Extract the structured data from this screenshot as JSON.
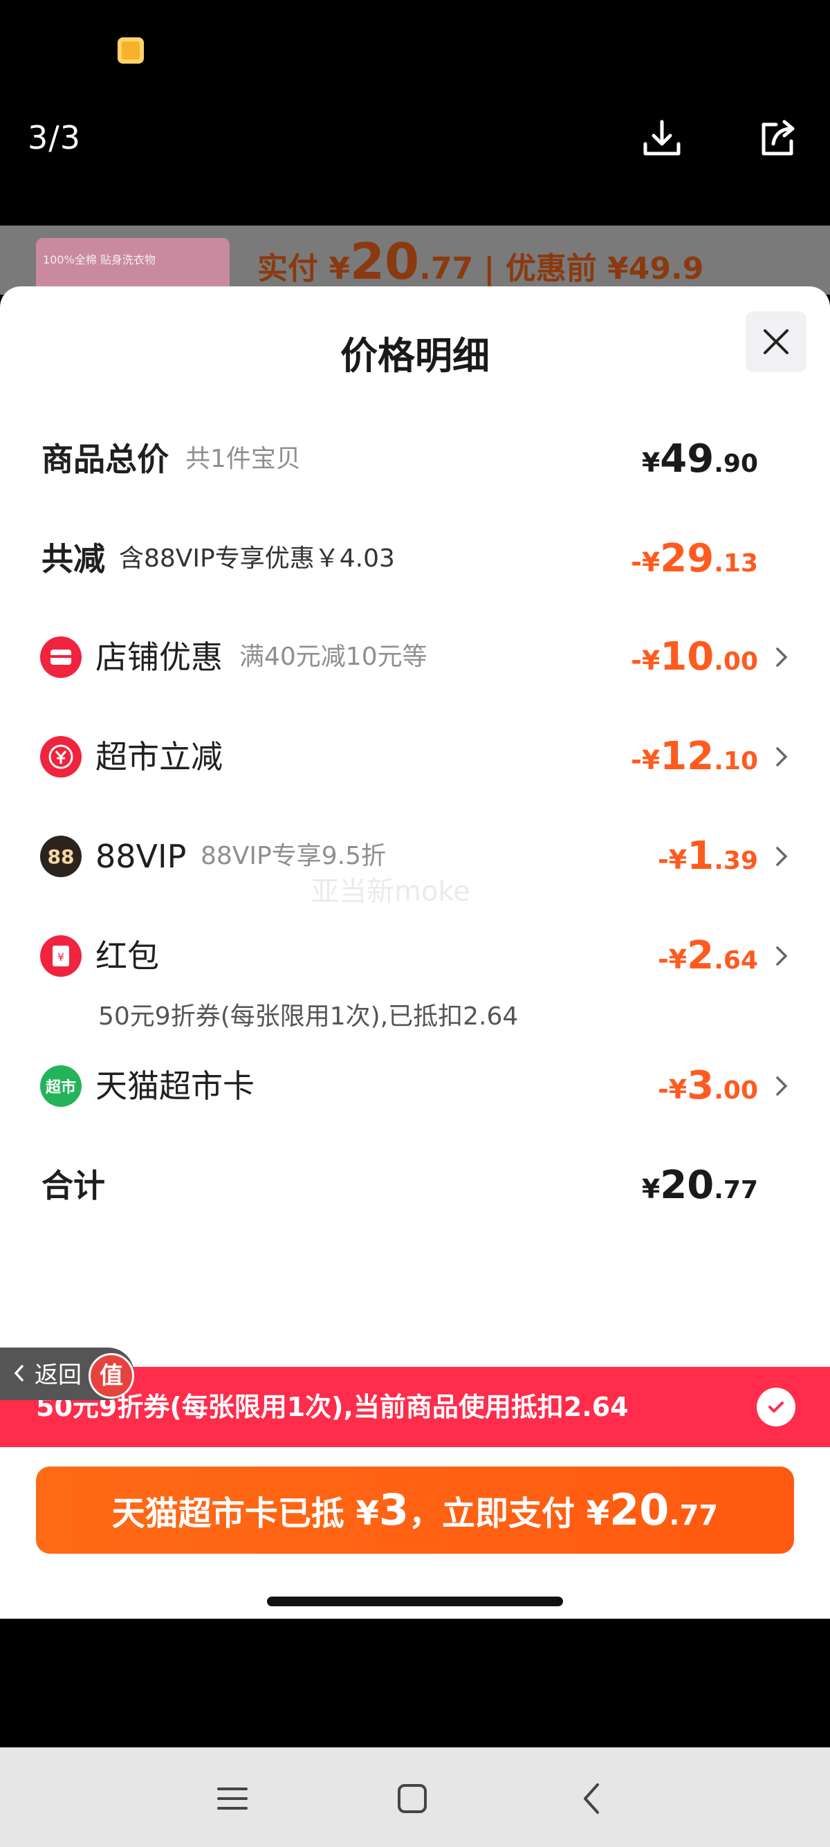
{
  "viewer": {
    "page_counter": "3/3",
    "icons": [
      "download-icon",
      "share-icon"
    ]
  },
  "background_product": {
    "thumb_text": "100%全棉 贴身洗衣物",
    "price_label": "实付 ¥",
    "price_int": "20",
    "price_dec": ".77",
    "before_label": "| 优惠前 ¥49.9"
  },
  "sheet": {
    "title": "价格明细",
    "close_icon": "close-icon",
    "rows": {
      "total": {
        "label": "商品总价",
        "sub": "共1件宝贝",
        "cur": "¥",
        "int": "49",
        "dec": ".90"
      },
      "discount": {
        "label": "共减",
        "sub": "含88VIP专享优惠￥4.03",
        "cur": "-¥",
        "int": "29",
        "dec": ".13"
      },
      "shop": {
        "label": "店铺优惠",
        "sub": "满40元减10元等",
        "cur": "-¥",
        "int": "10",
        "dec": ".00"
      },
      "supermarket": {
        "label": "超市立减",
        "cur": "-¥",
        "int": "12",
        "dec": ".10"
      },
      "vip": {
        "icon_text": "88",
        "label": "88VIP",
        "sub": "88VIP专享9.5折",
        "cur": "-¥",
        "int": "1",
        "dec": ".39"
      },
      "redpacket": {
        "label": "红包",
        "note": "50元9折券(每张限用1次),已抵扣2.64",
        "cur": "-¥",
        "int": "2",
        "dec": ".64"
      },
      "card": {
        "icon_text": "超市",
        "label": "天猫超市卡",
        "cur": "-¥",
        "int": "3",
        "dec": ".00"
      },
      "sum": {
        "label": "合计",
        "cur": "¥",
        "int": "20",
        "dec": ".77"
      }
    },
    "watermark": "亚当新moke",
    "back_label": "返回",
    "zhi_badge": "值",
    "coupon_banner": "50元9折券(每张限用1次),当前商品使用抵扣2.64",
    "pay_button": {
      "prefix": "天猫超市卡已抵 ¥",
      "deducted": "3",
      "middle": "，立即支付 ¥",
      "pay_int": "20",
      "pay_dec": ".77"
    }
  },
  "colors": {
    "accent_orange": "#ff5a1f",
    "banner_red": "#ff2c4c",
    "pay_orange": "#ff6a14"
  },
  "android_nav": [
    "menu-icon",
    "home-icon",
    "back-icon"
  ]
}
